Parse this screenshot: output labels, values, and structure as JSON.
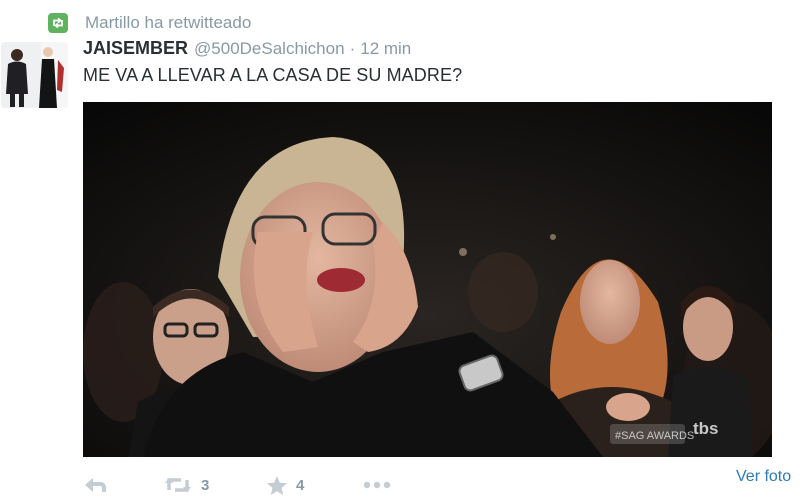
{
  "retweet_context": {
    "label": "Martillo ha retwitteado",
    "icon": "retweet-icon",
    "badge_color": "#5fb25f"
  },
  "tweet": {
    "author_name": "JAISEMBER",
    "author_handle": "@500DeSalchichon",
    "separator": "·",
    "timestamp": "12 min",
    "text": "ME VA A LLEVAR A LA CASA DE SU MADRE?",
    "media": {
      "watermark_left": "#SAG AWARDS",
      "watermark_right": "tbs"
    }
  },
  "actions": {
    "reply_icon": "reply-icon",
    "retweet_icon": "retweet-icon",
    "retweet_count": "3",
    "favorite_icon": "star-icon",
    "favorite_count": "4",
    "more_icon": "more-dots-icon",
    "view_photo_label": "Ver foto"
  },
  "colors": {
    "muted_text": "#8899a6",
    "body_text": "#292f33",
    "link": "#2b7bb9"
  }
}
